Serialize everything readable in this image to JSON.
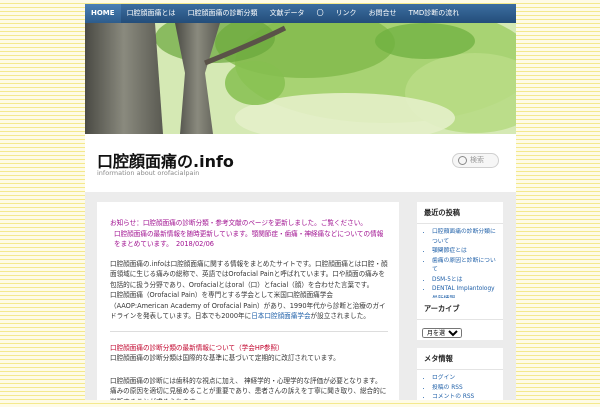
{
  "nav": {
    "items": [
      "HOME",
      "口腔顔面痛とは",
      "口腔顔面痛の診断分類",
      "文献データ",
      "〇",
      "リンク",
      "お問合せ",
      "TMD診断の流れ"
    ]
  },
  "site": {
    "title": "口腔顔面痛の.info",
    "tagline": "information about orofacialpain",
    "search_placeholder": "検索"
  },
  "main": {
    "notice_line1": "お知らせ：口腔顔面痛の診断分類・参考文献のページを更新しました。ご覧ください。",
    "notice_line2": "口腔顔面痛の最新情報を随時更新しています。顎関節症・歯痛・神経痛などについての情報をまとめています。　2018/02/06",
    "intro": "口腔顔面痛の.infoは口腔顔面痛に関する情報をまとめたサイトです。口腔顔面痛とは口腔・顔面領域に生じる痛みの総称で、英語ではOrofacial Painと呼ばれています。口や顔面の痛みを包括的に扱う分野であり、Orofacialとはoral（口）とfacial（顔）を合わせた言葉です。",
    "intro2_prefix": "口腔顔面痛（Orofacial Pain）を専門とする学会として米国口腔顔面痛学会（AAOP:American Academy of Orofacial Pain）があり、1990年代から診断と治療のガイドラインを発表しています。日本でも2000年に",
    "intro2_link": "日本口腔顔面痛学会",
    "intro2_suffix": "が設立されました。",
    "section_title": "口腔顔面痛の診断分類の最新情報について（学会HP参照）",
    "section_text": "口腔顔面痛の診断分類は国際的な基準に基づいて定期的に改訂されています。",
    "para3": "口腔顔面痛の診断には歯科的な視点に加え、 神経学的・心理学的な評価が必要となります。痛みの原因を適切に見極めることが重要であり、患者さんの訴えを丁寧に聞き取り、総合的に判断することが求められます。"
  },
  "sidebar": {
    "w1_title": "最近の投稿",
    "w1_items": [
      "口腔顔面痛の診断分類について",
      "顎関節症とは",
      "歯痛の原因と診断について",
      "DSM-5とは",
      "DENTAL Implantology最新情報"
    ],
    "w2_title": "アーカイブ",
    "w2_select": "月を選択",
    "w3_title": "メタ情報",
    "w3_items": [
      "ログイン",
      "投稿の RSS",
      "コメントの RSS"
    ]
  }
}
